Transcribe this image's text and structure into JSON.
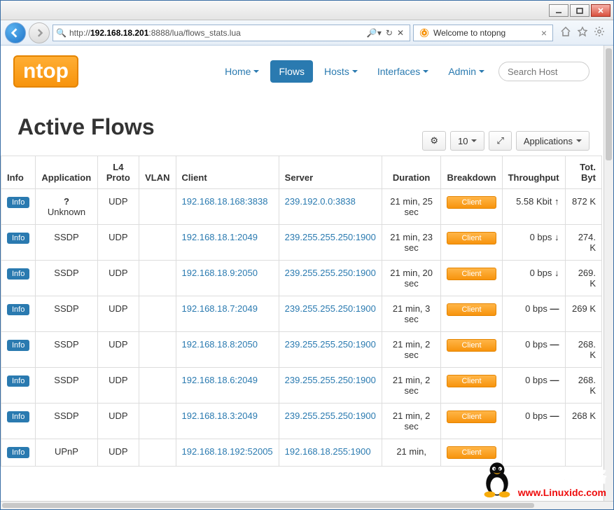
{
  "browser": {
    "url_prefix": "http://",
    "url_ip": "192.168.18.201",
    "url_rest": ":8888/lua/flows_stats.lua",
    "tab_title": "Welcome to ntopng"
  },
  "nav": {
    "logo_text": "ntop",
    "items": [
      "Home",
      "Flows",
      "Hosts",
      "Interfaces",
      "Admin"
    ],
    "active_index": 1,
    "search_placeholder": "Search Host"
  },
  "page_title": "Active Flows",
  "toolbar": {
    "gear": "⚙",
    "count": "10",
    "expand": "⤢",
    "apps_label": "Applications"
  },
  "columns": {
    "info": "Info",
    "application": "Application",
    "l4": "L4 Proto",
    "vlan": "VLAN",
    "client": "Client",
    "server": "Server",
    "duration": "Duration",
    "breakdown": "Breakdown",
    "throughput": "Throughput",
    "bytes": "Tot. Byt"
  },
  "labels": {
    "info_btn": "Info",
    "client_btn": "Client"
  },
  "rows": [
    {
      "app": "Unknown",
      "app_icon": "?",
      "l4": "UDP",
      "vlan": "",
      "client": "192.168.18.168:3838",
      "server": "239.192.0.0:3838",
      "duration": "21 min, 25 sec",
      "throughput": "5.58 Kbit",
      "arrow": "↑",
      "bytes": "872 K"
    },
    {
      "app": "SSDP",
      "app_icon": "",
      "l4": "UDP",
      "vlan": "",
      "client": "192.168.18.1:2049",
      "server": "239.255.255.250:1900",
      "duration": "21 min, 23 sec",
      "throughput": "0 bps",
      "arrow": "↓",
      "bytes": "274. K"
    },
    {
      "app": "SSDP",
      "app_icon": "",
      "l4": "UDP",
      "vlan": "",
      "client": "192.168.18.9:2050",
      "server": "239.255.255.250:1900",
      "duration": "21 min, 20 sec",
      "throughput": "0 bps",
      "arrow": "↓",
      "bytes": "269. K"
    },
    {
      "app": "SSDP",
      "app_icon": "",
      "l4": "UDP",
      "vlan": "",
      "client": "192.168.18.7:2049",
      "server": "239.255.255.250:1900",
      "duration": "21 min, 3 sec",
      "throughput": "0 bps",
      "arrow": "—",
      "bytes": "269 K"
    },
    {
      "app": "SSDP",
      "app_icon": "",
      "l4": "UDP",
      "vlan": "",
      "client": "192.168.18.8:2050",
      "server": "239.255.255.250:1900",
      "duration": "21 min, 2 sec",
      "throughput": "0 bps",
      "arrow": "—",
      "bytes": "268. K"
    },
    {
      "app": "SSDP",
      "app_icon": "",
      "l4": "UDP",
      "vlan": "",
      "client": "192.168.18.6:2049",
      "server": "239.255.255.250:1900",
      "duration": "21 min, 2 sec",
      "throughput": "0 bps",
      "arrow": "—",
      "bytes": "268. K"
    },
    {
      "app": "SSDP",
      "app_icon": "",
      "l4": "UDP",
      "vlan": "",
      "client": "192.168.18.3:2049",
      "server": "239.255.255.250:1900",
      "duration": "21 min, 2 sec",
      "throughput": "0 bps",
      "arrow": "—",
      "bytes": "268 K"
    },
    {
      "app": "UPnP",
      "app_icon": "",
      "l4": "UDP",
      "vlan": "",
      "client": "192.168.18.192:52005",
      "server": "192.168.18.255:1900",
      "duration": "21 min,",
      "throughput": "",
      "arrow": "",
      "bytes": ""
    }
  ],
  "watermark": {
    "text_cn": "黑区网络",
    "text_url": "www.Linuxidc.com"
  }
}
